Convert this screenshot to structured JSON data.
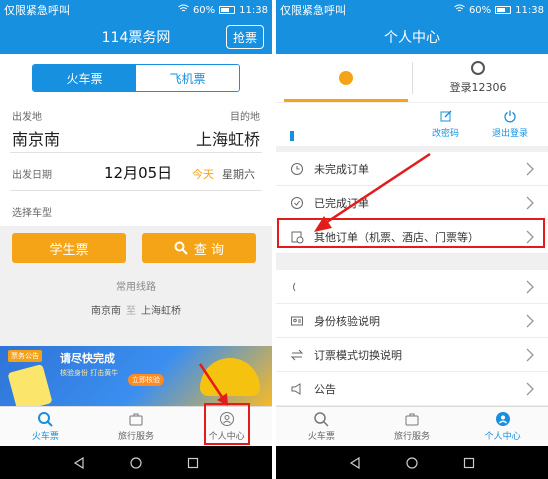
{
  "left": {
    "status": {
      "carrier": "仅限紧急呼叫",
      "battery": "60%",
      "time": "11:38"
    },
    "appbar": {
      "title": "114票务网",
      "grab_button": "抢票"
    },
    "tabs": {
      "train": "火车票",
      "plane": "飞机票"
    },
    "route": {
      "from_label": "出发地",
      "to_label": "目的地",
      "from_city": "南京南",
      "to_city": "上海虹桥",
      "date_label": "出发日期",
      "date_value": "12月05日",
      "today": "今天",
      "weekday": "星期六",
      "car_type_label": "选择车型"
    },
    "buttons": {
      "student": "学生票",
      "query": "查 询"
    },
    "common_routes": {
      "title": "常用线路",
      "from": "南京南",
      "sep": "至",
      "to": "上海虹桥"
    },
    "banner": {
      "tag": "票务公告",
      "title": "请尽快完成",
      "subtitle": "核验身份  打击黄牛",
      "button": "立即核验"
    },
    "bottom_nav": [
      {
        "label": "火车票",
        "icon": "search-icon"
      },
      {
        "label": "旅行服务",
        "icon": "suitcase-icon"
      },
      {
        "label": "个人中心",
        "icon": "person-icon"
      }
    ],
    "colors": {
      "brand": "#1790df",
      "accent": "#f6a417",
      "highlight": "#e31b1b"
    }
  },
  "right": {
    "status": {
      "carrier": "仅限紧急呼叫",
      "battery": "60%",
      "time": "11:38"
    },
    "appbar": {
      "title": "个人中心"
    },
    "login_12306": "登录12306",
    "actions": {
      "change_password": "改密码",
      "logout": "退出登录"
    },
    "menu": [
      {
        "label": "未完成订单",
        "icon": "clock-icon"
      },
      {
        "label": "已完成订单",
        "icon": "check-clock-icon"
      },
      {
        "label": "其他订单（机票、酒店、门票等）",
        "icon": "other-orders-icon"
      },
      {
        "label": "",
        "icon": "blank-icon"
      },
      {
        "label": "身份核验说明",
        "icon": "id-card-icon"
      },
      {
        "label": "订票模式切换说明",
        "icon": "switch-icon"
      },
      {
        "label": "公告",
        "icon": "megaphone-icon"
      }
    ],
    "bottom_nav": [
      {
        "label": "火车票",
        "icon": "search-icon"
      },
      {
        "label": "旅行服务",
        "icon": "suitcase-icon"
      },
      {
        "label": "个人中心",
        "icon": "person-icon"
      }
    ]
  }
}
